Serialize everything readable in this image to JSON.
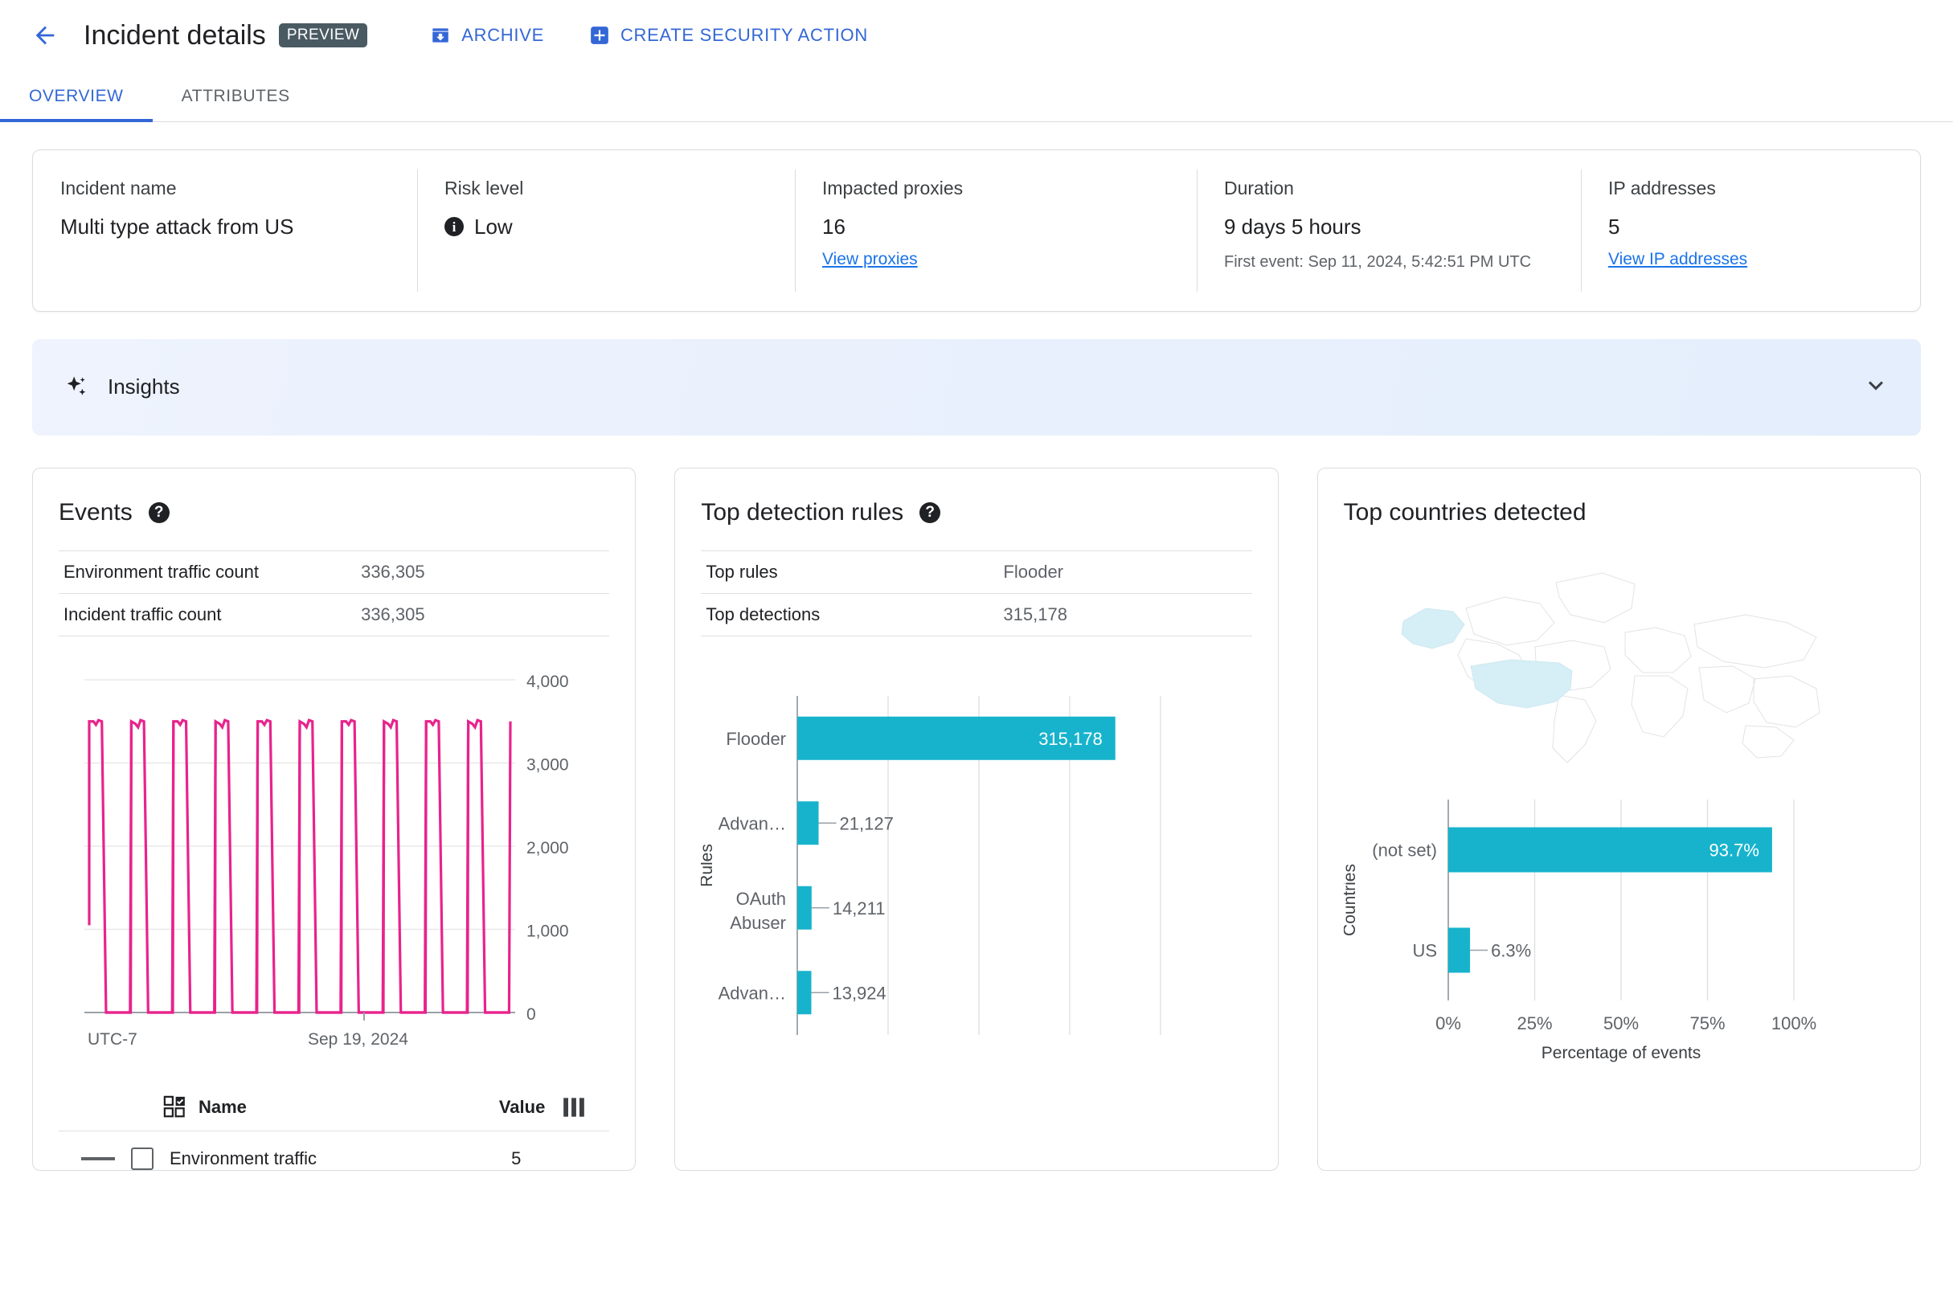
{
  "header": {
    "back_icon": "arrow-back-icon",
    "title": "Incident details",
    "preview_badge": "PREVIEW",
    "actions": [
      {
        "label": "ARCHIVE",
        "icon": "archive-icon"
      },
      {
        "label": "CREATE SECURITY ACTION",
        "icon": "plus-box-icon"
      }
    ]
  },
  "tabs": [
    {
      "label": "OVERVIEW",
      "active": true
    },
    {
      "label": "ATTRIBUTES",
      "active": false
    }
  ],
  "summary": {
    "incident_name": {
      "label": "Incident name",
      "value": "Multi type attack from US"
    },
    "risk_level": {
      "label": "Risk level",
      "value": "Low",
      "icon": "info-icon"
    },
    "impacted_proxies": {
      "label": "Impacted proxies",
      "value": "16",
      "link": "View proxies"
    },
    "duration": {
      "label": "Duration",
      "value": "9 days 5 hours",
      "sub": "First event: Sep 11, 2024, 5:42:51 PM UTC"
    },
    "ip_addresses": {
      "label": "IP addresses",
      "value": "5",
      "link": "View IP addresses"
    }
  },
  "insights": {
    "title": "Insights",
    "icon": "sparkle-icon",
    "chevron": "chevron-down-icon"
  },
  "events_panel": {
    "title": "Events",
    "help_icon": "help-icon",
    "rows": [
      {
        "key": "Environment traffic count",
        "value": "336,305"
      },
      {
        "key": "Incident traffic count",
        "value": "336,305"
      }
    ],
    "legend": {
      "name_header": "Name",
      "value_header": "Value",
      "select_icon": "checklist-icon",
      "columns_icon": "columns-icon",
      "items": [
        {
          "name": "Environment traffic",
          "value": "5"
        }
      ]
    }
  },
  "rules_panel": {
    "title": "Top detection rules",
    "help_icon": "help-icon",
    "rows": [
      {
        "key": "Top rules",
        "value": "Flooder"
      },
      {
        "key": "Top detections",
        "value": "315,178"
      }
    ]
  },
  "countries_panel": {
    "title": "Top countries detected",
    "map_highlight": "US"
  },
  "colors": {
    "accent_blue": "#3367d6",
    "link_blue": "#1a73e8",
    "teal_bar": "#17b3cc",
    "pink_line": "#e8238c",
    "map_highlight": "#d6eef5",
    "border": "#dadce0"
  },
  "chart_data": [
    {
      "id": "events-timeseries",
      "type": "line",
      "title": "Events",
      "xlabel": "",
      "ylabel": "",
      "ylim": [
        0,
        4000
      ],
      "ytick_labels": [
        "0",
        "1,000",
        "2,000",
        "3,000",
        "4,000"
      ],
      "yticks": [
        0,
        1000,
        2000,
        3000,
        4000
      ],
      "xtick_labels": [
        "UTC-7",
        "Sep 19, 2024"
      ],
      "grid": true,
      "series": [
        {
          "name": "Environment traffic",
          "color": "#e8238c",
          "peak": 3500,
          "cycles": 10,
          "values": [
            1050,
            3500,
            3500,
            0,
            3450,
            3490,
            3480,
            3500,
            0,
            3470,
            3450,
            3500,
            0,
            3500,
            3500,
            0,
            3480,
            3430,
            3500,
            3520,
            0,
            3500,
            3500,
            0,
            3480,
            3440,
            3490,
            0,
            3500,
            3500,
            0,
            3470,
            3450,
            3510,
            0,
            3500,
            3500,
            0,
            3500,
            3500,
            0
          ]
        }
      ]
    },
    {
      "id": "top-detection-rules",
      "type": "bar",
      "orientation": "horizontal",
      "title": "Top detection rules",
      "xlabel": "",
      "ylabel": "Rules",
      "xlim": [
        0,
        360000
      ],
      "grid": true,
      "categories": [
        "Flooder",
        "Advan…",
        "OAuth Abuser",
        "Advan…"
      ],
      "values": [
        315178,
        21127,
        14211,
        13924
      ],
      "value_labels": [
        "315,178",
        "21,127",
        "14,211",
        "13,924"
      ],
      "bar_color": "#17b3cc"
    },
    {
      "id": "top-countries-detected",
      "type": "bar",
      "orientation": "horizontal",
      "title": "Top countries detected",
      "xlabel": "Percentage of events",
      "ylabel": "Countries",
      "xlim": [
        0,
        100
      ],
      "xtick_labels": [
        "0%",
        "25%",
        "50%",
        "75%",
        "100%"
      ],
      "xticks": [
        0,
        25,
        50,
        75,
        100
      ],
      "grid": true,
      "categories": [
        "(not set)",
        "US"
      ],
      "values": [
        93.7,
        6.3
      ],
      "value_labels": [
        "93.7%",
        "6.3%"
      ],
      "bar_color": "#17b3cc"
    }
  ]
}
